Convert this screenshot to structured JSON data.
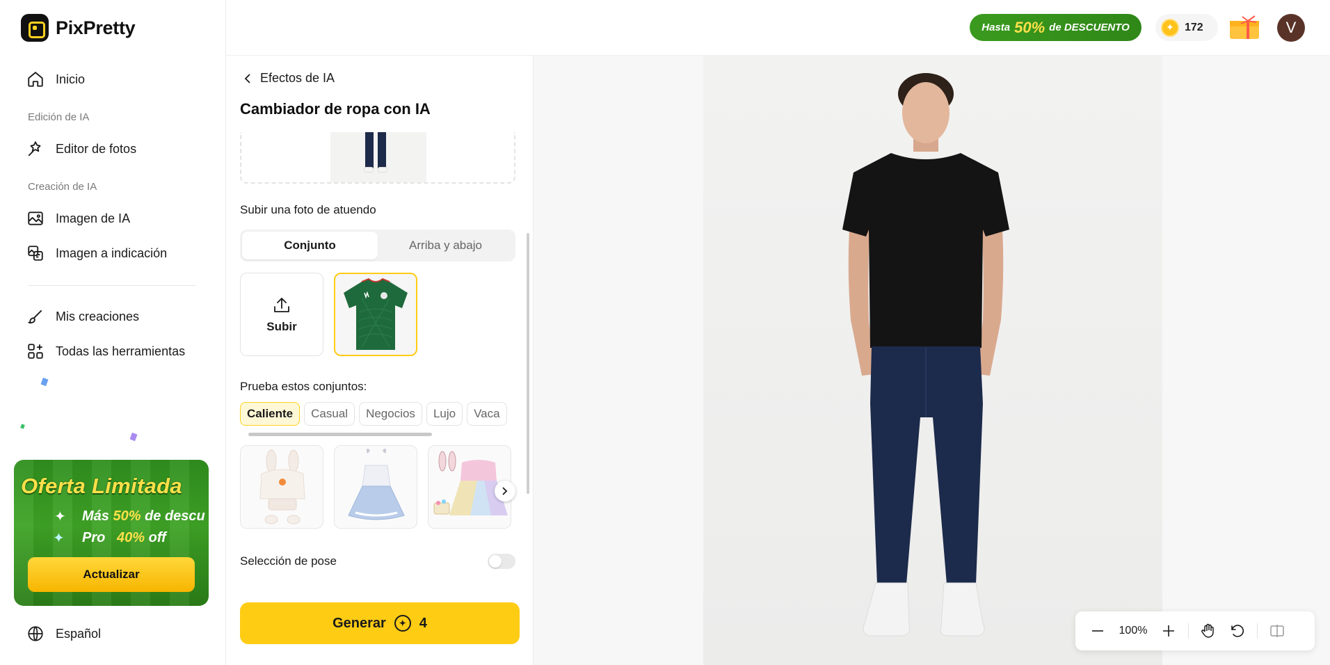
{
  "app": {
    "name": "PixPretty"
  },
  "sidebar": {
    "home": "Inicio",
    "section_edit": "Edición de IA",
    "photo_editor": "Editor de fotos",
    "section_create": "Creación de IA",
    "ai_image": "Imagen de IA",
    "image_to_prompt": "Imagen a indicación",
    "my_creations": "Mis creaciones",
    "all_tools": "Todas las herramientas",
    "language": "Español"
  },
  "promo": {
    "title": "Oferta Limitada",
    "line1_prefix": "Más",
    "line1_highlight": "50%",
    "line1_suffix": "de descu",
    "line2_prefix": "Pro",
    "line2_highlight": "40%",
    "line2_suffix": "off",
    "button": "Actualizar"
  },
  "topbar": {
    "discount_prefix": "Hasta",
    "discount_highlight": "50%",
    "discount_suffix": "de DESCUENTO",
    "credits": "172",
    "avatar_initial": "V"
  },
  "panel": {
    "back_label": "Efectos de IA",
    "title": "Cambiador de ropa con IA",
    "outfit_upload_label": "Subir una foto de atuendo",
    "segment": {
      "left": "Conjunto",
      "right": "Arriba y abajo",
      "active": "left"
    },
    "upload_button": "Subir",
    "try_outfits_label": "Prueba estos conjuntos:",
    "chips": [
      "Caliente",
      "Casual",
      "Negocios",
      "Lujo",
      "Vaca"
    ],
    "active_chip": "Caliente",
    "pose_label": "Selección de pose",
    "pose_enabled": false,
    "generate_label": "Generar",
    "generate_cost": "4"
  },
  "canvas": {
    "zoom": "100%"
  },
  "colors": {
    "accent": "#ffcc14",
    "promo_green": "#3a9a1e",
    "brand_dark": "#111111"
  }
}
